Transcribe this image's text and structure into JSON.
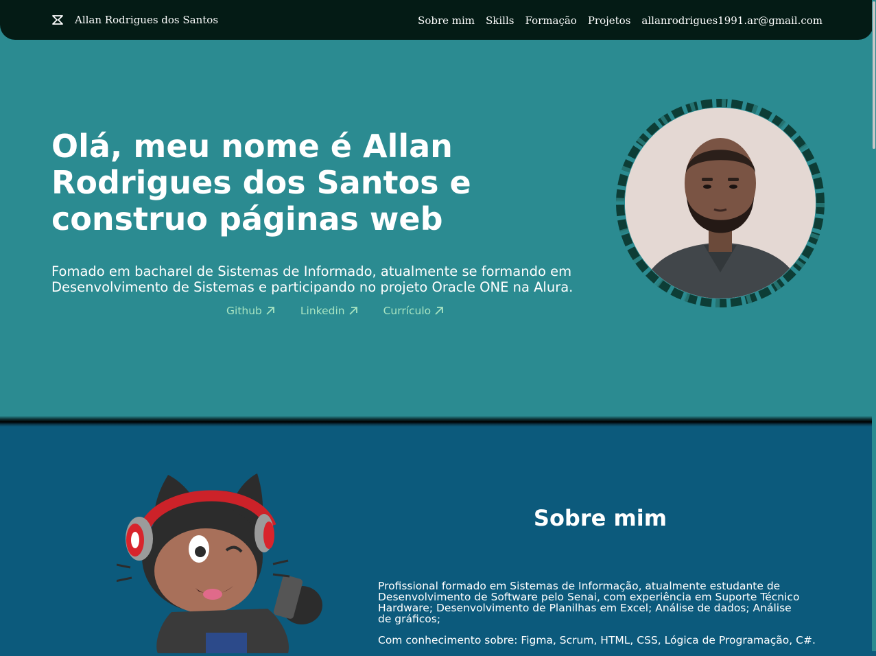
{
  "header": {
    "brand_name": "Allan Rodrigues dos Santos",
    "brand_icon": "sigma-icon",
    "nav": [
      "Sobre mim",
      "Skills",
      "Formação",
      "Projetos",
      "allanrodrigues1991.ar@gmail.com"
    ]
  },
  "hero": {
    "title": "Olá, meu nome é Allan Rodrigues dos Santos e construo páginas web",
    "description": "Fomado em bacharel de Sistemas de Informado, atualmente se formando em Desenvolvimento de Sistemas e participando no projeto Oracle ONE na Alura.",
    "links": [
      {
        "label": "Github",
        "icon": "arrow-up-right-icon"
      },
      {
        "label": "Linkedin",
        "icon": "arrow-up-right-icon"
      },
      {
        "label": "Currículo",
        "icon": "arrow-up-right-icon"
      }
    ]
  },
  "about": {
    "title": "Sobre mim",
    "text": "Profissional formado em Sistemas de Informação, atualmente estudante de Desenvolvimento de Software pelo Senai, com experiência em Suporte Técnico Hardware; Desenvolvimento de Planilhas em Excel; Análise de dados; Análise de gráficos;",
    "skills": "Com conhecimento sobre: Figma, Scrum, HTML, CSS, Lógica de Programação, C#."
  },
  "colors": {
    "header_bg": "#041b15",
    "hero_bg": "#2b8b91",
    "about_bg": "#0c5a7c",
    "link_color": "#a8e4c2",
    "text": "#ffffff"
  }
}
